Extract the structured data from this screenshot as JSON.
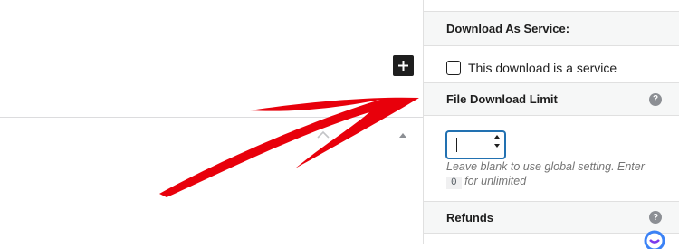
{
  "sidebar": {
    "download_as_service": {
      "title": "Download As Service:"
    },
    "service_checkbox": {
      "label": "This download is a service",
      "checked": false
    },
    "file_download_limit": {
      "title": "File Download Limit",
      "help": "?"
    },
    "limit_input": {
      "value": ""
    },
    "hint": {
      "before": "Leave blank to use global setting. Enter",
      "code": "0",
      "after": "for unlimited"
    },
    "refunds": {
      "title": "Refunds",
      "help": "?"
    }
  },
  "icons": {
    "add_block": "plus-icon",
    "collapse": "chevron-up-icon",
    "move_up": "caret-up-icon",
    "annotation": "red-arrow",
    "help": "question-circle-icon",
    "chat": "chat-bubble-icon"
  },
  "colors": {
    "accent": "#2271b1",
    "annotation_red": "#e8000b",
    "header_bg": "#f6f7f7",
    "help_grey": "#8c8f94"
  }
}
